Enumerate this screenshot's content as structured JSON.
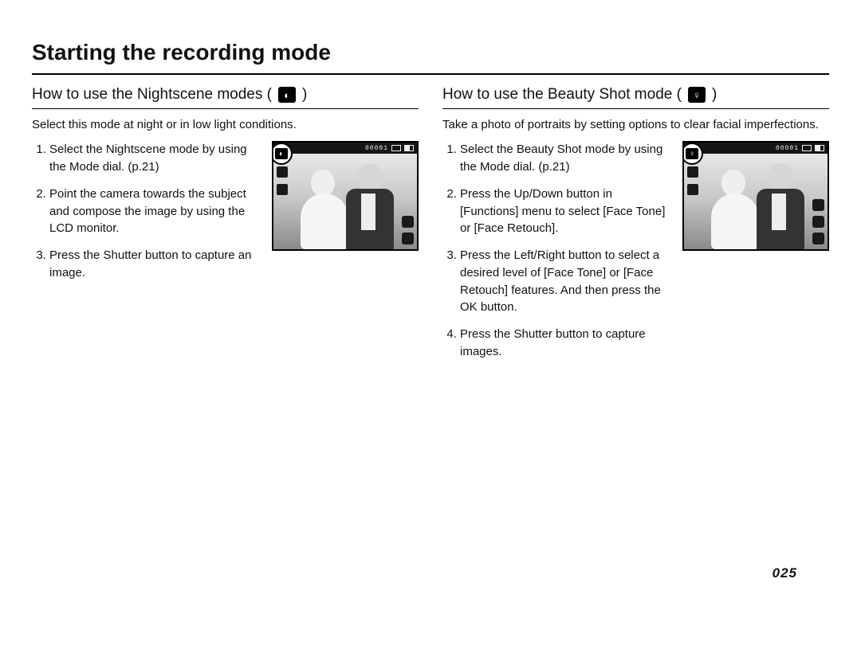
{
  "title": "Starting the recording mode",
  "pageNumber": "025",
  "left": {
    "heading_pre": "How to use the Nightscene modes ( ",
    "heading_post": " )",
    "icon_glyph": "◐",
    "icon_name": "nightscene-mode-icon",
    "intro": "Select this mode at night or in low light conditions.",
    "steps": [
      "Select the Nightscene mode by using the Mode dial. (p.21)",
      "Point the camera towards the subject and compose the image by using the LCD monitor.",
      "Press the Shutter button to capture an image."
    ],
    "lcd": {
      "shots": "00001",
      "mode_glyph": "◐"
    }
  },
  "right": {
    "heading_pre": "How to use the Beauty Shot mode ( ",
    "heading_post": " )",
    "icon_glyph": "♀",
    "icon_name": "beauty-shot-mode-icon",
    "intro": "Take a photo of portraits by setting options to clear facial imperfections.",
    "steps": [
      "Select the Beauty Shot mode by using the Mode dial. (p.21)",
      "Press the Up/Down button in [Functions] menu to select [Face Tone] or [Face Retouch].",
      "Press the Left/Right button to select a desired level of [Face Tone] or [Face Retouch] features. And then press the OK button.",
      "Press the Shutter button to capture images."
    ],
    "lcd": {
      "shots": "00001",
      "mode_glyph": "♀"
    }
  }
}
